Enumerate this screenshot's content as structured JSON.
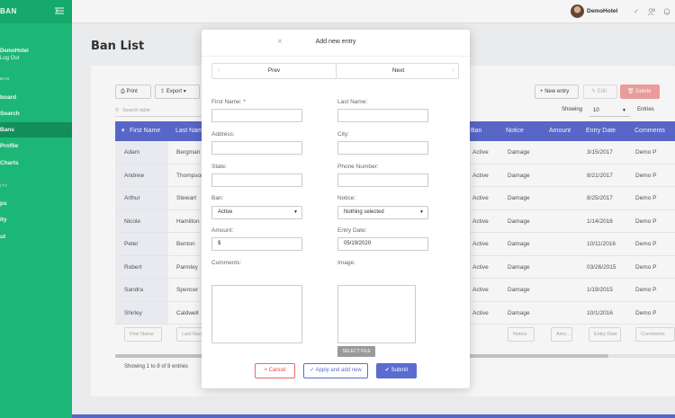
{
  "sidebar": {
    "brand": "BAN",
    "user_name": "DemoHotel",
    "logout": "Log Out",
    "section_ban": "BAN",
    "items": [
      {
        "label": "board"
      },
      {
        "label": "Search"
      },
      {
        "label": "Bans"
      },
      {
        "label": "Profile"
      },
      {
        "label": "Charts"
      }
    ],
    "section_utility": "ITY",
    "items2": [
      {
        "label": "ps"
      },
      {
        "label": "ity"
      },
      {
        "label": "ut"
      }
    ]
  },
  "topbar": {
    "user_name": "DemoHotel",
    "icons": [
      "check-icon",
      "users-icon",
      "bell-icon"
    ]
  },
  "page": {
    "title": "Ban List"
  },
  "toolbar": {
    "print": "Print",
    "export": "Export",
    "new_entry": "New entry",
    "edit": "Edit",
    "delete": "Delete",
    "search_placeholder": "Search table",
    "showing_label": "Showing",
    "showing_value": "10",
    "entries_label": "Entries"
  },
  "table": {
    "columns": [
      "First Name",
      "Last Name",
      "Ban",
      "Notice",
      "Amount",
      "Entry Date",
      "Comments"
    ],
    "rows": [
      {
        "first": "Adam",
        "last": "Bergman",
        "ban": "Active",
        "notice": "Damage",
        "date": "3/15/2017",
        "comments": "Demo P"
      },
      {
        "first": "Andrew",
        "last": "Thompson",
        "ban": "Active",
        "notice": "Damage",
        "date": "8/21/2017",
        "comments": "Demo P"
      },
      {
        "first": "Arthur",
        "last": "Stewart",
        "ban": "Active",
        "notice": "Damage",
        "date": "8/25/2017",
        "comments": "Demo P"
      },
      {
        "first": "Nicole",
        "last": "Hamilton",
        "ban": "Active",
        "notice": "Damage",
        "date": "1/14/2016",
        "comments": "Demo P"
      },
      {
        "first": "Peter",
        "last": "Benton",
        "ban": "Active",
        "notice": "Damage",
        "date": "10/11/2016",
        "comments": "Demo P"
      },
      {
        "first": "Robert",
        "last": "Parmley",
        "ban": "Active",
        "notice": "Damage",
        "date": "03/26/2015",
        "comments": "Demo P"
      },
      {
        "first": "Sandra",
        "last": "Spencer",
        "ban": "Active",
        "notice": "Damage",
        "date": "1/19/2015",
        "comments": "Demo P"
      },
      {
        "first": "Shirley",
        "last": "Caldwell",
        "ban": "Active",
        "notice": "Damage",
        "date": "10/1/2016",
        "comments": "Demo P"
      }
    ],
    "filters": {
      "first": "First Name",
      "last": "Last Name",
      "notice": "Notice",
      "amount": "Amo...",
      "date": "Entry Date",
      "comments": "Comments"
    },
    "info": "Showing 1 to 8 of 8 entries"
  },
  "modal": {
    "title": "Add new entry",
    "prev": "Prev",
    "next": "Next",
    "fields": {
      "first_name_label": "First Name: *",
      "last_name_label": "Last Name:",
      "address_label": "Address:",
      "city_label": "City:",
      "state_label": "State:",
      "phone_label": "Phone Number:",
      "ban_label": "Ban:",
      "ban_value": "Active",
      "notice_label": "Notice:",
      "notice_value": "Nothing selected",
      "amount_label": "Amount:",
      "amount_value": "$",
      "entry_date_label": "Entry Date:",
      "entry_date_value": "05/19/2020",
      "comments_label": "Comments:",
      "image_label": "Image:",
      "select_file": "SELECT FILE"
    },
    "buttons": {
      "cancel": "Cancel",
      "apply": "Apply and add new",
      "submit": "Submit"
    }
  },
  "colors": {
    "sidebar": "#1ebf7c",
    "accent": "#5b6bd0",
    "danger": "#f3a3a0"
  }
}
